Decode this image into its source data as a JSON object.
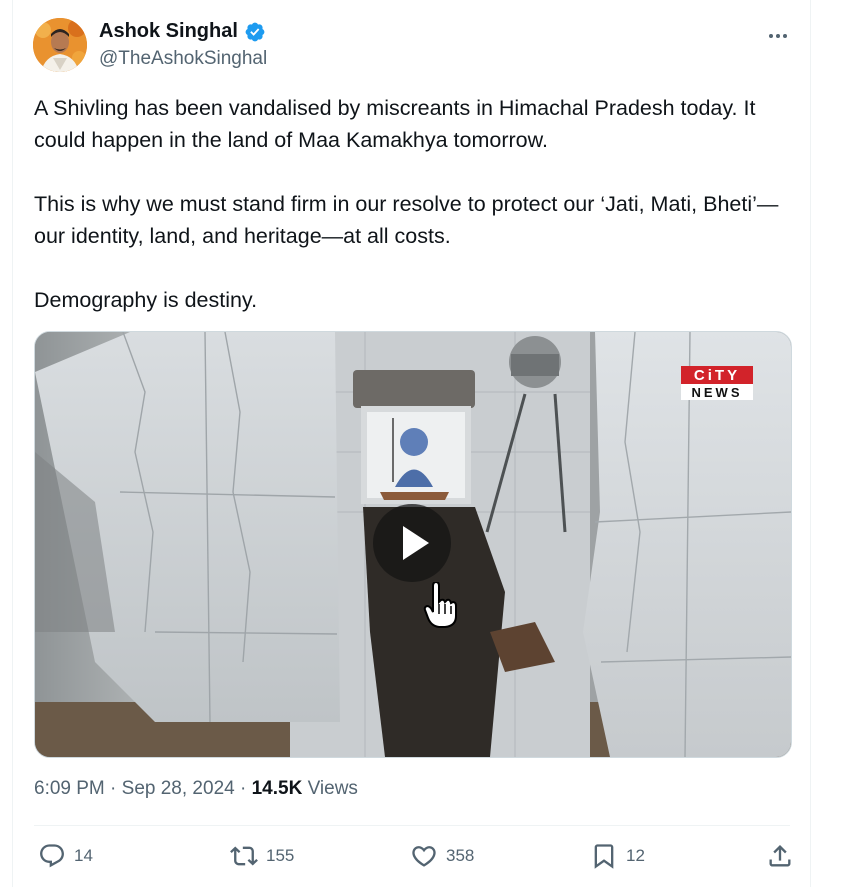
{
  "author": {
    "name": "Ashok Singhal",
    "handle": "@TheAshokSinghal",
    "verified": true,
    "verified_color": "#1d9bf0"
  },
  "tweet": {
    "paragraphs": [
      "A Shivling has been vandalised by miscreants in Himachal Pradesh today. It could happen in the land of Maa Kamakhya tomorrow.",
      "This is why we must stand firm in our resolve to protect our ‘Jati, Mati, Bheti’—our identity, land, and heritage—at all costs.",
      "Demography is destiny."
    ]
  },
  "media": {
    "type": "video",
    "watermark_line1": "CiTY",
    "watermark_line2": "NEWS"
  },
  "meta": {
    "time": "6:09 PM",
    "date": "Sep 28, 2024",
    "views_count": "14.5K",
    "views_label": "Views",
    "separator": "·"
  },
  "actions": {
    "replies": "14",
    "reposts": "155",
    "likes": "358",
    "bookmarks": "12"
  },
  "icons": {
    "more": "more-horizontal-icon",
    "verified": "verified-badge-icon",
    "play": "play-icon",
    "reply": "reply-icon",
    "repost": "repost-icon",
    "like": "heart-icon",
    "bookmark": "bookmark-icon",
    "share": "share-icon"
  },
  "colors": {
    "text": "#0f1419",
    "secondary": "#536471",
    "divider": "#eff3f4",
    "accent": "#1d9bf0"
  }
}
